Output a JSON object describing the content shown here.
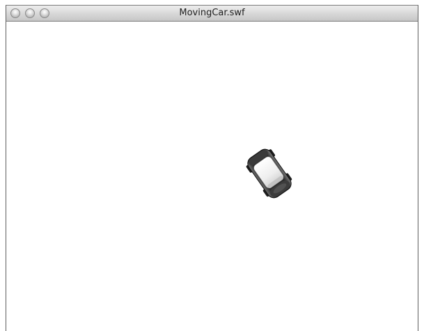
{
  "window": {
    "title": "MovingCar.swf"
  },
  "stage": {
    "background": "#ffffff",
    "sprite": {
      "name": "car",
      "heading_deg": 55,
      "body_color": "#f2f2f2",
      "tire_color": "#1c1c1c"
    }
  }
}
